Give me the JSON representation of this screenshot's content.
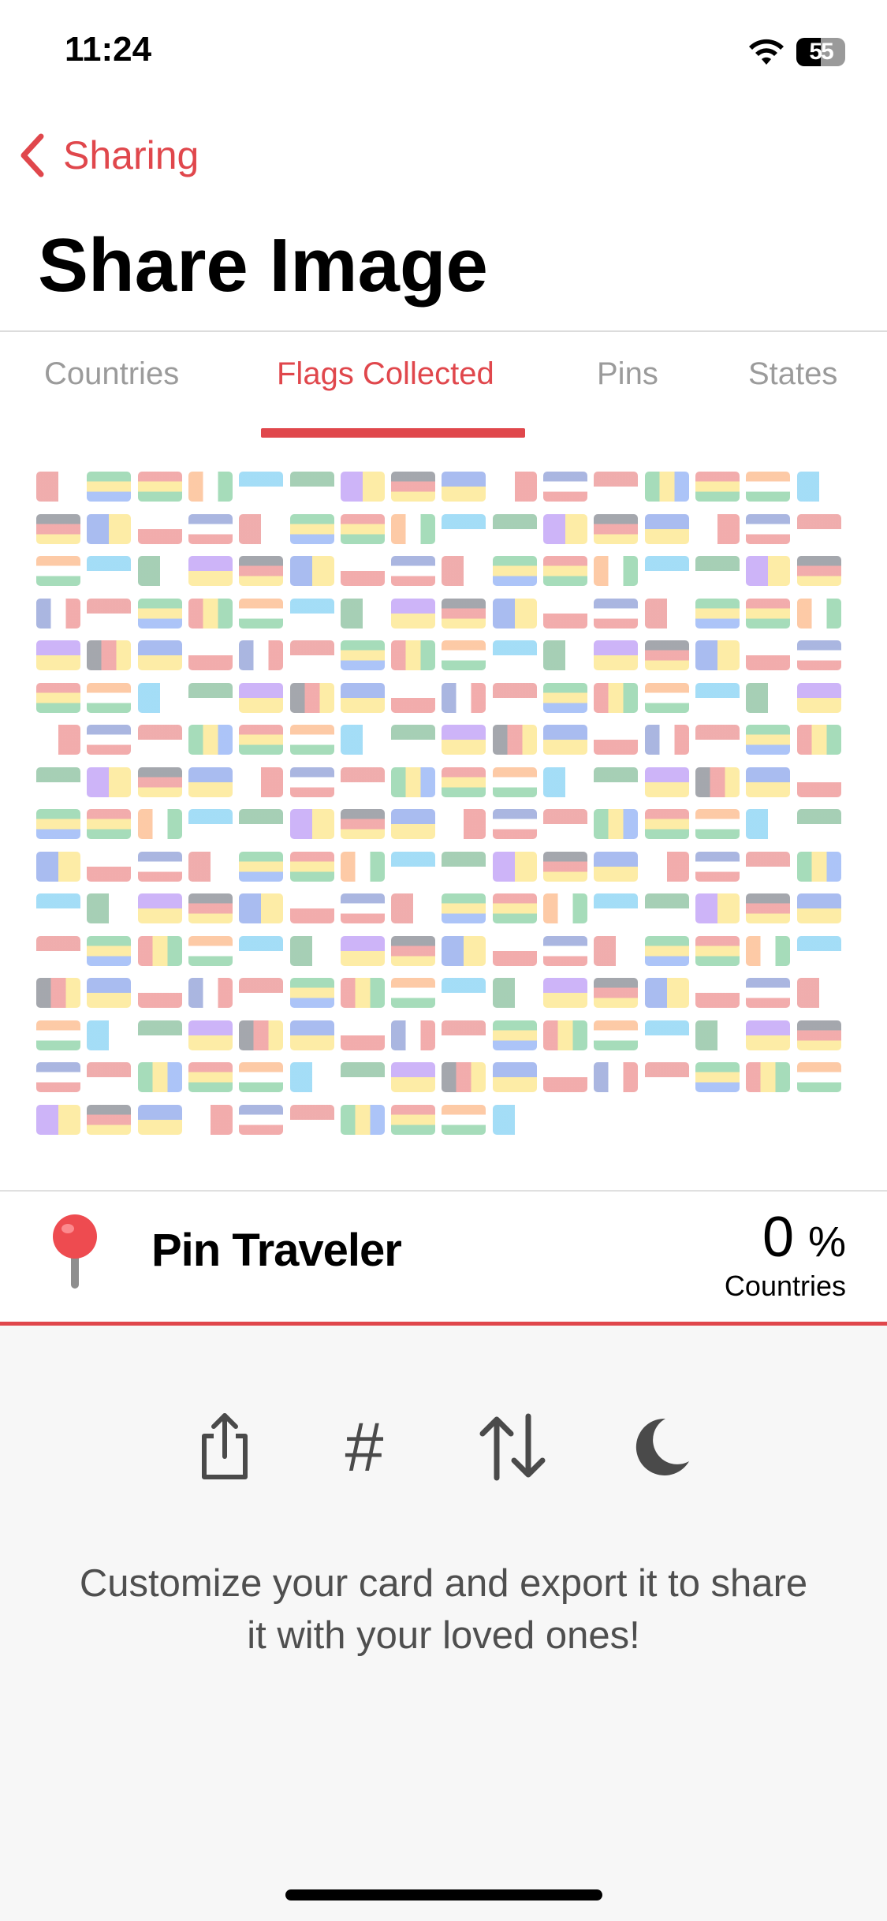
{
  "status_bar": {
    "time": "11:24",
    "battery": "55"
  },
  "nav": {
    "back_label": "Sharing",
    "title": "Share Image"
  },
  "tabs": [
    {
      "label": "Countries",
      "active": false
    },
    {
      "label": "Flags Collected",
      "active": true
    },
    {
      "label": "Pins",
      "active": false
    },
    {
      "label": "States",
      "active": false
    }
  ],
  "card": {
    "name": "Pin Traveler",
    "stat_value": "0",
    "stat_unit": "%",
    "stat_label": "Countries"
  },
  "toolbar": [
    {
      "icon": "share-icon"
    },
    {
      "icon": "hashtag-icon",
      "glyph": "#"
    },
    {
      "icon": "sort-arrows-icon"
    },
    {
      "icon": "moon-icon"
    }
  ],
  "hint": "Customize your card and export it to share it with your loved ones!",
  "colors": {
    "accent": "#e0474c",
    "icon_gray": "#4a4a4a",
    "panel_bg": "#f7f7f7"
  }
}
